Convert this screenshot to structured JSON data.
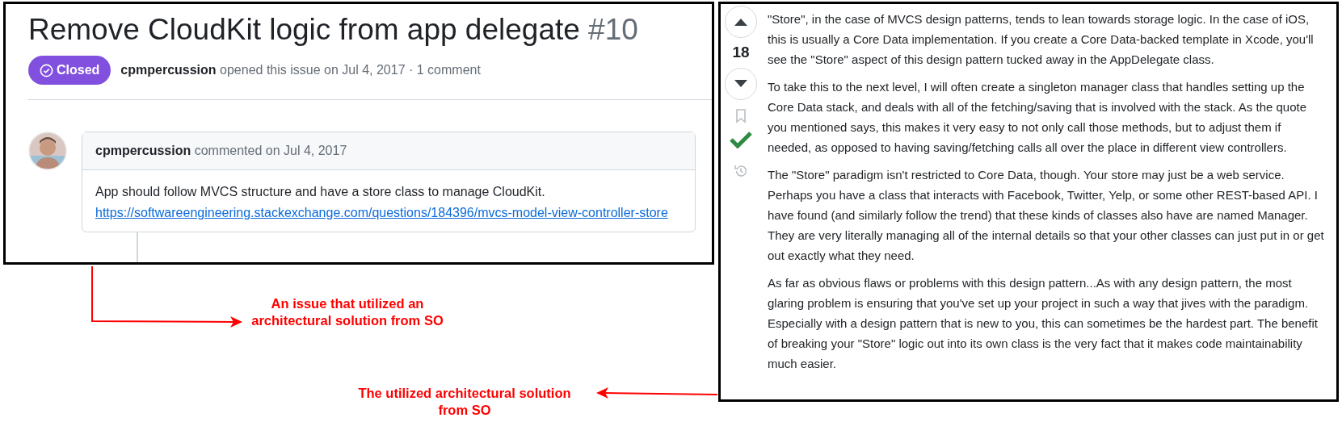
{
  "issue": {
    "title": "Remove CloudKit logic from app delegate",
    "number": "#10",
    "state_label": "Closed",
    "author": "cpmpercussion",
    "meta": "opened this issue on Jul 4, 2017 · 1 comment"
  },
  "comment": {
    "author": "cpmpercussion",
    "meta": "commented on Jul 4, 2017",
    "body": "App should follow MVCS structure and have a store class to manage CloudKit.",
    "link": "https://softwareengineering.stackexchange.com/questions/184396/mvcs-model-view-controller-store"
  },
  "answer": {
    "votes": "18",
    "accepted": true,
    "paragraphs": [
      "\"Store\", in the case of MVCS design patterns, tends to lean towards storage logic. In the case of iOS, this is usually a Core Data implementation. If you create a Core Data-backed template in Xcode, you'll see the \"Store\" aspect of this design pattern tucked away in the AppDelegate class.",
      "To take this to the next level, I will often create a singleton manager class that handles setting up the Core Data stack, and deals with all of the fetching/saving that is involved with the stack. As the quote you mentioned says, this makes it very easy to not only call those methods, but to adjust them if needed, as opposed to having saving/fetching calls all over the place in different view controllers.",
      "The \"Store\" paradigm isn't restricted to Core Data, though. Your store may just be a web service. Perhaps you have a class that interacts with Facebook, Twitter, Yelp, or some other REST-based API. I have found (and similarly follow the trend) that these kinds of classes also have are named Manager. They are very literally managing all of the internal details so that your other classes can just put in or get out exactly what they need.",
      "As far as obvious flaws or problems with this design pattern...As with any design pattern, the most glaring problem is ensuring that you've set up your project in such a way that jives with the paradigm. Especially with a design pattern that is new to you, this can sometimes be the hardest part. The benefit of breaking your \"Store\" logic out into its own class is the very fact that it makes code maintainability much easier."
    ]
  },
  "annotations": [
    "An issue that utilized an architectural solution from SO",
    "The utilized architectural solution from SO"
  ]
}
